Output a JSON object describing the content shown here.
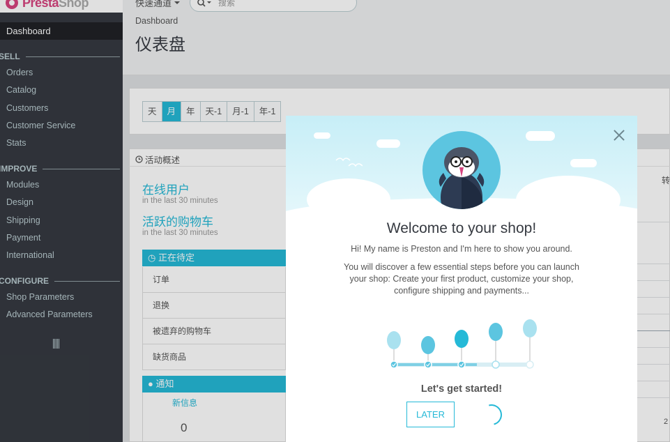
{
  "logo": {
    "text_a": "Presta",
    "text_b": "Shop"
  },
  "sidebar": {
    "active": "Dashboard",
    "sections": [
      {
        "label": "SELL",
        "items": [
          "Orders",
          "Catalog",
          "Customers",
          "Customer Service",
          "Stats"
        ]
      },
      {
        "label": "IMPROVE",
        "items": [
          "Modules",
          "Design",
          "Shipping",
          "Payment",
          "International"
        ]
      },
      {
        "label": "CONFIGURE",
        "items": [
          "Shop Parameters",
          "Advanced Parameters"
        ]
      }
    ]
  },
  "header": {
    "quick_access": "快速通道",
    "search_placeholder": "搜索",
    "breadcrumb": "Dashboard",
    "page_title": "仪表盘"
  },
  "period": {
    "buttons": [
      "天",
      "月",
      "年",
      "天-1",
      "月-1",
      "年-1"
    ],
    "selected": "月"
  },
  "activity": {
    "title": "活动概述",
    "online_label": "在线用户",
    "online_sub": "in the last 30 minutes",
    "carts_label": "活跃的购物车",
    "carts_sub": "in the last 30 minutes",
    "pending_title": "正在待定",
    "pending_rows": [
      "订单",
      "退换",
      "被遗弃的购物车",
      "缺货商品"
    ],
    "notif_title": "通知",
    "notif_label": "新信息",
    "notif_value": "0"
  },
  "right_edge": {
    "label_char": "转",
    "date_char": "2"
  },
  "modal": {
    "title": "Welcome to your shop!",
    "line1": "Hi! My name is Preston and I'm here to show you around.",
    "line2": "You will discover a few essential steps before you can launch your shop: Create your first product, customize your shop, configure shipping and payments...",
    "cta": "Let's get started!",
    "later_button": "LATER",
    "close_icon": "close-icon",
    "progress": {
      "total_steps": 5,
      "completed_steps": 3
    }
  },
  "colors": {
    "accent": "#25b9d7",
    "sidebar_bg": "#363a41",
    "brand": "#d6447f"
  }
}
